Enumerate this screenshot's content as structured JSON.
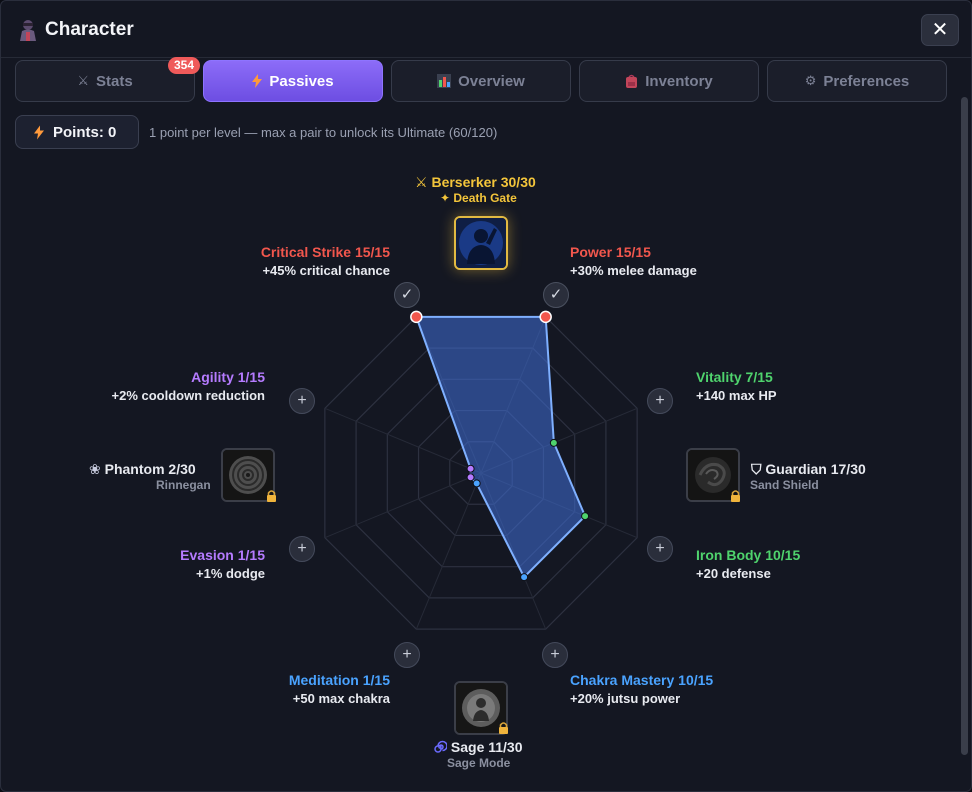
{
  "window": {
    "title": "Character",
    "icon": "ninja-icon",
    "close_icon": "close-icon"
  },
  "tabs": [
    {
      "label": "Stats",
      "icon": "crossed-swords-icon",
      "active": false,
      "badge": "354"
    },
    {
      "label": "Passives",
      "icon": "lightning-icon",
      "active": true
    },
    {
      "label": "Overview",
      "icon": "bar-chart-icon",
      "active": false
    },
    {
      "label": "Inventory",
      "icon": "backpack-icon",
      "active": false
    },
    {
      "label": "Preferences",
      "icon": "gear-icon",
      "active": false
    }
  ],
  "points": {
    "label": "Points: 0",
    "icon": "lightning-icon",
    "note": "1 point per level — max a pair to unlock its Ultimate (60/120)"
  },
  "passives": {
    "critical_strike": {
      "name": "Critical Strike 15/15",
      "desc": "+45% critical chance",
      "color": "#f2574d",
      "value": 15,
      "max": 15,
      "action": "check"
    },
    "power": {
      "name": "Power 15/15",
      "desc": "+30% melee damage",
      "color": "#f2574d",
      "value": 15,
      "max": 15,
      "action": "check"
    },
    "vitality": {
      "name": "Vitality 7/15",
      "desc": "+140 max HP",
      "color": "#4fd36d",
      "value": 7,
      "max": 15,
      "action": "plus"
    },
    "iron_body": {
      "name": "Iron Body 10/15",
      "desc": "+20 defense",
      "color": "#4fd36d",
      "value": 10,
      "max": 15,
      "action": "plus"
    },
    "chakra_mastery": {
      "name": "Chakra Mastery 10/15",
      "desc": "+20% jutsu power",
      "color": "#4aa3ff",
      "value": 10,
      "max": 15,
      "action": "plus"
    },
    "meditation": {
      "name": "Meditation 1/15",
      "desc": "+50 max chakra",
      "color": "#4aa3ff",
      "value": 1,
      "max": 15,
      "action": "plus"
    },
    "evasion": {
      "name": "Evasion 1/15",
      "desc": "+1% dodge",
      "color": "#b57bff",
      "value": 1,
      "max": 15,
      "action": "plus"
    },
    "agility": {
      "name": "Agility 1/15",
      "desc": "+2% cooldown reduction",
      "color": "#b57bff",
      "value": 1,
      "max": 15,
      "action": "plus"
    }
  },
  "ultimates": {
    "berserker": {
      "name": "Berserker 30/30",
      "sub": "✦ Death Gate",
      "icon": "crossed-swords-icon",
      "unlocked": true
    },
    "guardian": {
      "name": "Guardian 17/30",
      "sub": "Sand Shield",
      "icon": "shield-icon",
      "unlocked": false
    },
    "sage": {
      "name": "Sage 11/30",
      "sub": "Sage Mode",
      "icon": "spiral-icon",
      "unlocked": false
    },
    "phantom": {
      "name": "Phantom 2/30",
      "sub": "Rinnegan",
      "icon": "ghost-icon",
      "unlocked": false
    }
  },
  "check_glyph": "✓",
  "plus_glyph": "+",
  "close_glyph": "✕",
  "colors": {
    "accent": "#7c5cf0",
    "radar_fill": "#3f6fd8",
    "radar_stroke": "#7fb0ff",
    "gold": "#f3c53b"
  }
}
